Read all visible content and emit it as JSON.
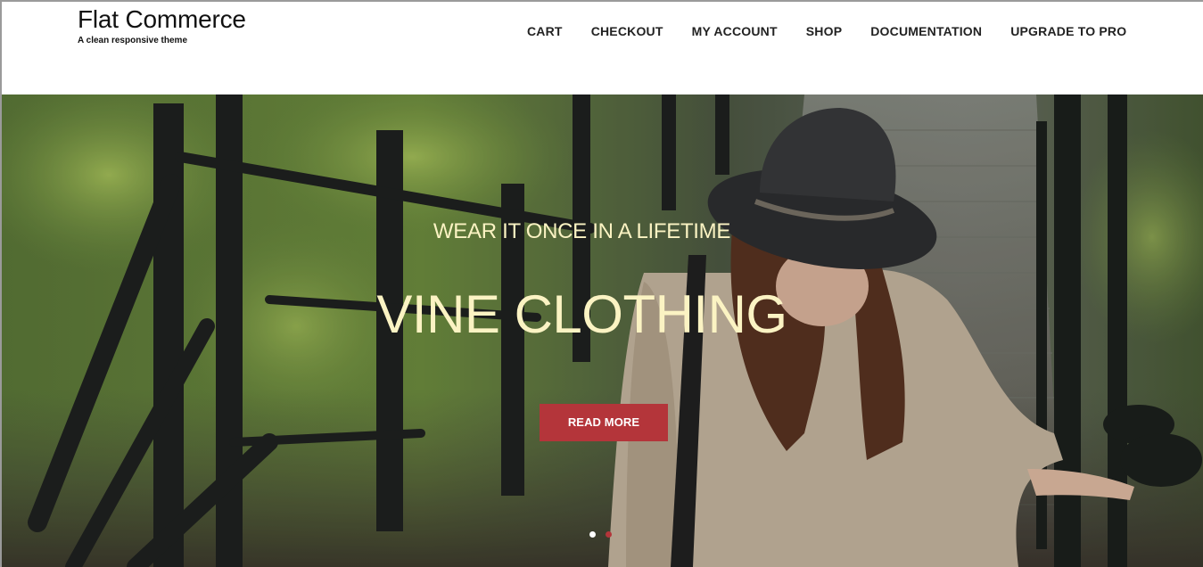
{
  "header": {
    "site_title": "Flat Commerce",
    "tagline": "A clean responsive theme"
  },
  "nav": {
    "items": [
      {
        "label": "CART"
      },
      {
        "label": "CHECKOUT"
      },
      {
        "label": "MY ACCOUNT"
      },
      {
        "label": "SHOP"
      },
      {
        "label": "DOCUMENTATION"
      },
      {
        "label": "UPGRADE TO PRO"
      }
    ]
  },
  "hero": {
    "subtitle": "WEAR IT ONCE IN A LIFETIME",
    "title": "VINE CLOTHING",
    "button_label": "READ MORE",
    "slides": 2,
    "active_slide": 1
  },
  "colors": {
    "accent": "#b4353a",
    "hero_text": "#fbf3c3",
    "nav_text": "#222222"
  }
}
